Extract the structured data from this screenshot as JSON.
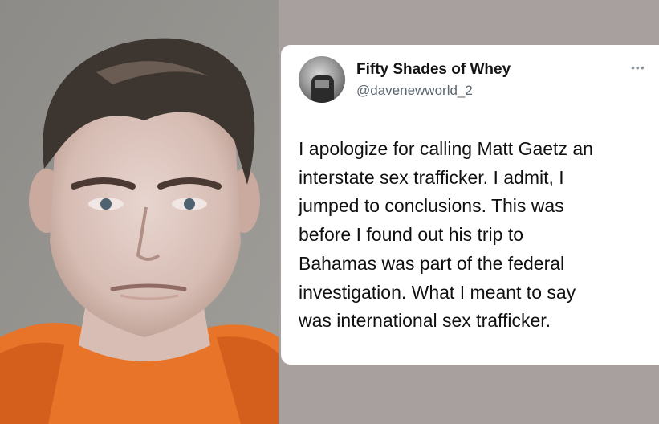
{
  "tweet": {
    "display_name": "Fifty Shades of Whey",
    "handle": "@davenewworld_2",
    "more_icon": "more-horizontal-icon",
    "text_lines": [
      "I apologize for calling Matt Gaetz an",
      "interstate sex trafficker. I admit, I",
      "jumped to conclusions. This was",
      "before I found out his trip to",
      "Bahamas was part of the federal",
      "investigation. What I meant to say",
      "was international sex trafficker."
    ]
  },
  "colors": {
    "background": "#a79e9f",
    "card": "#ffffff",
    "name_text": "#141414",
    "handle_text": "#5b6670",
    "body_text": "#101010",
    "shirt": "#e8742a"
  }
}
